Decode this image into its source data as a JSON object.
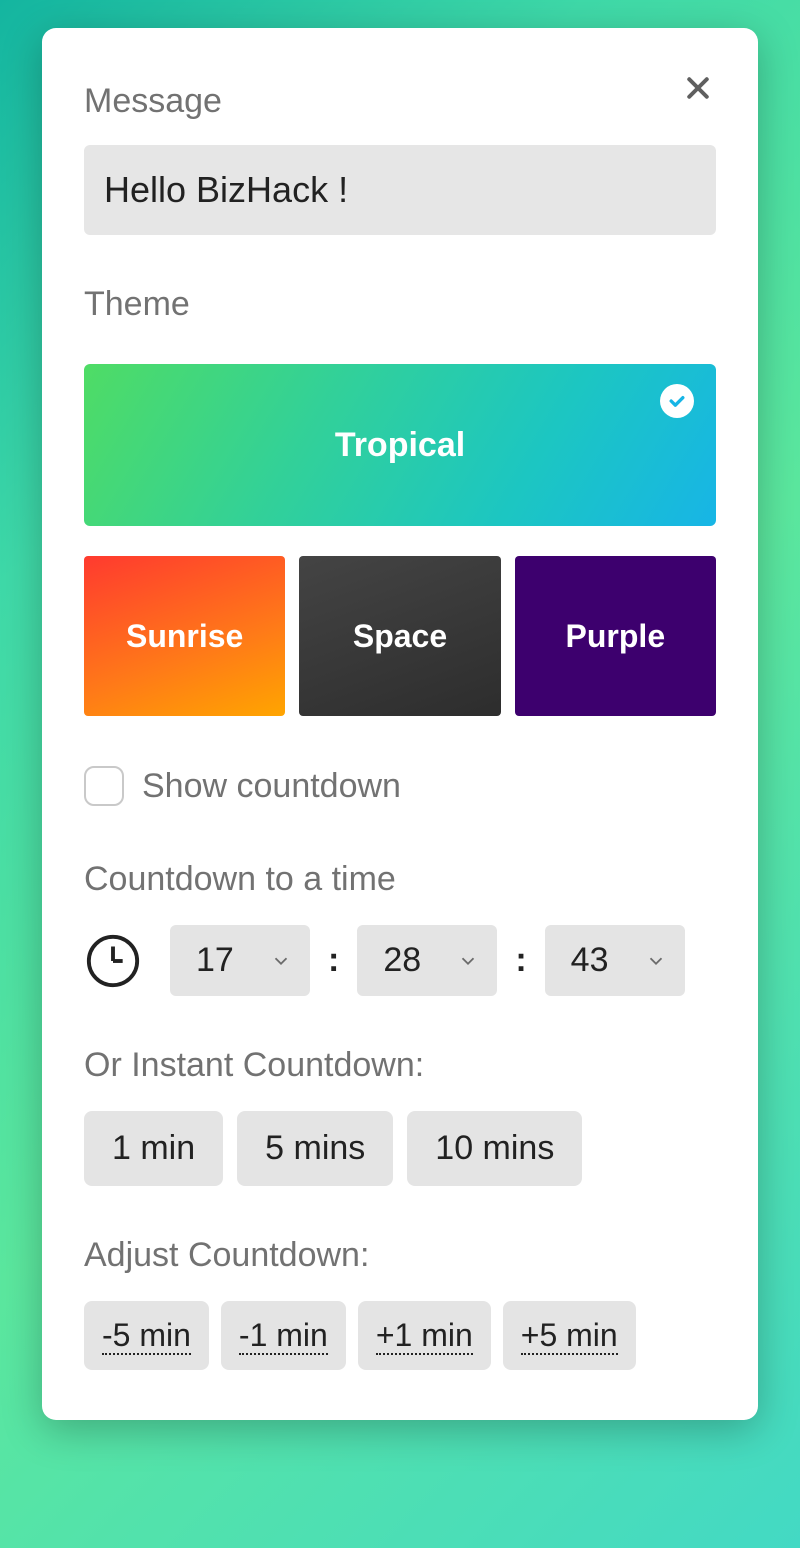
{
  "labels": {
    "message": "Message",
    "theme": "Theme",
    "showCountdown": "Show countdown",
    "countdownTo": "Countdown to a time",
    "instant": "Or Instant Countdown:",
    "adjust": "Adjust Countdown:"
  },
  "message": {
    "value": "Hello BizHack !"
  },
  "themes": {
    "selected": "Tropical",
    "options": [
      "Sunrise",
      "Space",
      "Purple"
    ]
  },
  "showCountdown": false,
  "time": {
    "h": "17",
    "m": "28",
    "s": "43"
  },
  "instant": [
    "1 min",
    "5 mins",
    "10 mins"
  ],
  "adjust": [
    "-5 min",
    "-1 min",
    "+1 min",
    "+5 min"
  ]
}
